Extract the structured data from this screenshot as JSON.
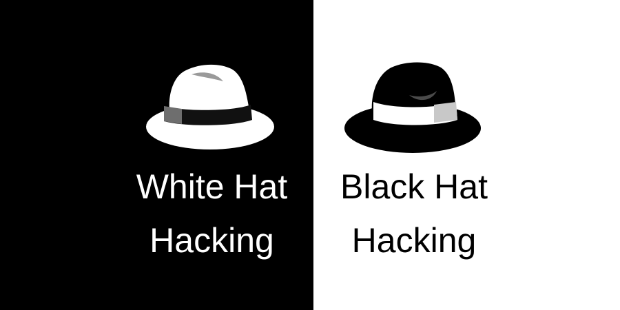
{
  "panels": {
    "left": {
      "background": "#000000",
      "hat": {
        "icon": "white-fedora-hat-icon",
        "hat_color": "#ffffff",
        "band_color": "#111111",
        "band_accent": "#6e6e6e"
      },
      "caption": {
        "line1": "White Hat",
        "line2": "Hacking",
        "color": "#ffffff"
      }
    },
    "right": {
      "background": "#ffffff",
      "hat": {
        "icon": "black-fedora-hat-icon",
        "hat_color": "#000000",
        "band_color": "#ffffff",
        "band_accent": "#c8c8c8"
      },
      "caption": {
        "line1": "Black Hat",
        "line2": "Hacking",
        "color": "#000000"
      }
    }
  }
}
